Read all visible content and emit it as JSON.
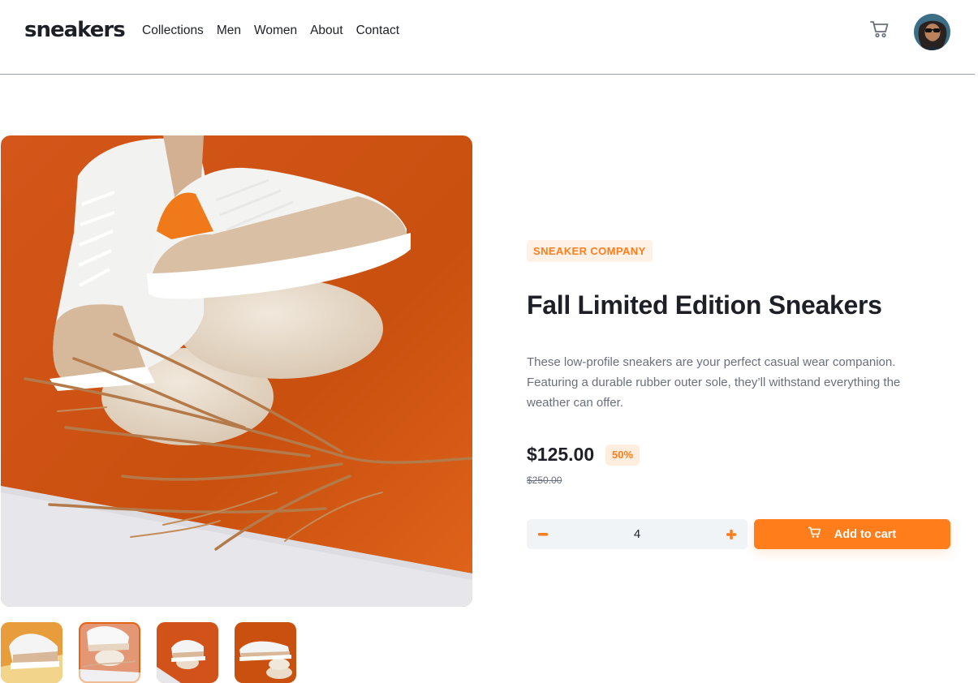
{
  "header": {
    "logo": "sneakers",
    "nav": [
      "Collections",
      "Men",
      "Women",
      "About",
      "Contact"
    ],
    "cart_icon": "cart-icon",
    "avatar_icon": "user-avatar"
  },
  "gallery": {
    "main_image": "sneakers-on-stones",
    "thumbnails": [
      "thumbnail-1",
      "thumbnail-2",
      "thumbnail-3",
      "thumbnail-4"
    ],
    "active_thumbnail": 2
  },
  "product": {
    "company": "SNEAKER COMPANY",
    "title": "Fall Limited Edition Sneakers",
    "description": "These low-profile sneakers are your perfect casual wear companion. Featuring a durable rubber outer sole, they’ll withstand everything the weather can offer.",
    "price": "$125.00",
    "discount": "50%",
    "original_price": "$250.00"
  },
  "cart_controls": {
    "quantity": "4",
    "minus_icon": "minus-icon",
    "plus_icon": "plus-icon",
    "add_label": "Add to cart"
  },
  "colors": {
    "accent": "#ff7d1a",
    "accent_pale": "#fff1e6",
    "text_dark": "#1d2026",
    "text_muted": "#69707d",
    "stepper_bg": "#f1f4f7"
  }
}
